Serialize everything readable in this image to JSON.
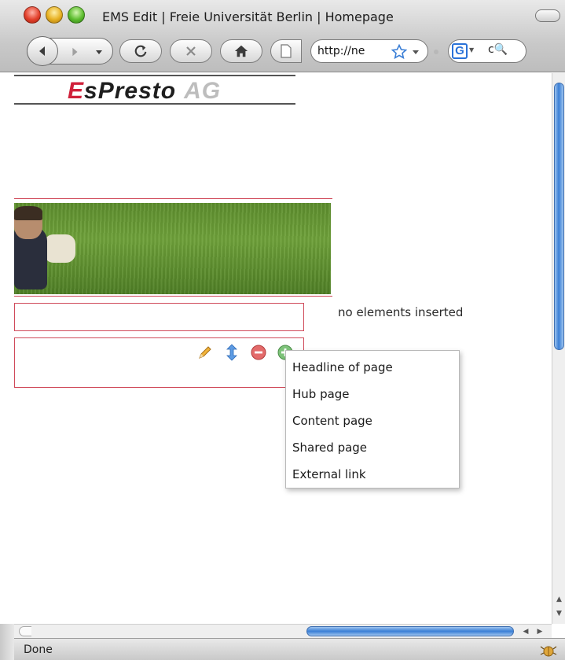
{
  "window": {
    "title": "EMS Edit | Freie Universität Berlin | Homepage"
  },
  "toolbar": {
    "url": "http://ne",
    "search_engine": "G"
  },
  "page": {
    "logo": {
      "part_e": "E",
      "part_rest": "sPresto",
      "part_ag": "AG"
    },
    "empty_message": "no elements inserted"
  },
  "menu": {
    "items": [
      {
        "label": "Headline of page"
      },
      {
        "label": "Hub page"
      },
      {
        "label": "Content page"
      },
      {
        "label": "Shared page"
      },
      {
        "label": "External link"
      }
    ]
  },
  "status": {
    "text": "Done"
  },
  "colors": {
    "accent_red": "#d04a5a",
    "scroll_blue": "#3a7fd6",
    "logo_red": "#d0213b"
  },
  "icons": {
    "edit": "pencil-icon",
    "move": "up-down-arrow-icon",
    "remove": "minus-circle-icon",
    "add": "plus-circle-icon"
  }
}
